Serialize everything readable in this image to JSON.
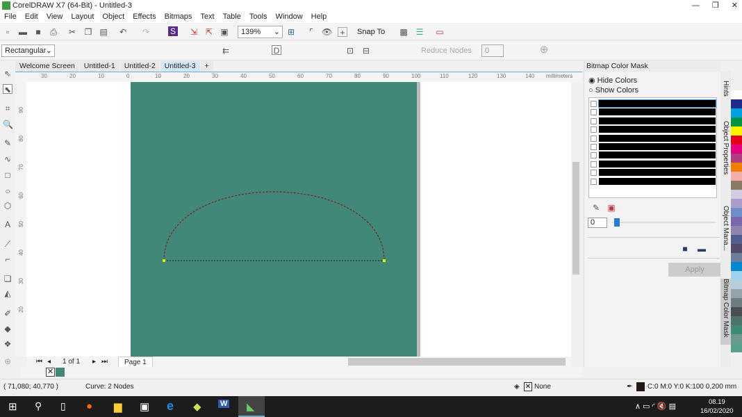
{
  "title": "CorelDRAW X7 (64-Bit) - Untitled-3",
  "menu": [
    "File",
    "Edit",
    "View",
    "Layout",
    "Object",
    "Effects",
    "Bitmaps",
    "Text",
    "Table",
    "Tools",
    "Window",
    "Help"
  ],
  "toolbar": {
    "zoom": "139%",
    "snap_to": "Snap To"
  },
  "property_bar": {
    "selection_mode": "Rectangular",
    "reduce_nodes": "Reduce Nodes",
    "smoothness": "0"
  },
  "tabs": [
    {
      "label": "Welcome Screen"
    },
    {
      "label": "Untitled-1"
    },
    {
      "label": "Untitled-2"
    },
    {
      "label": "Untitled-3",
      "active": true
    }
  ],
  "ruler": {
    "h_labels": [
      "30",
      "20",
      "10",
      "0",
      "10",
      "20",
      "30",
      "40",
      "50",
      "60",
      "70",
      "80",
      "90",
      "100",
      "110",
      "120",
      "130",
      "140"
    ],
    "units": "millimeters",
    "v_labels": [
      "90",
      "80",
      "70",
      "60",
      "50",
      "40",
      "30",
      "20"
    ]
  },
  "page_nav": {
    "count": "1 of 1",
    "page": "Page 1"
  },
  "docker": {
    "title": "Bitmap Color Mask",
    "hide": "Hide Colors",
    "show": "Show Colors",
    "hide_selected": true,
    "tolerance": "0",
    "apply": "Apply",
    "rows": 10
  },
  "docker_tabs": [
    "Hints",
    "Object Properties",
    "Object Mana...",
    "Bitmap Color Mask"
  ],
  "palette": [
    "#ffffff",
    "#1f2a8a",
    "#00a0e3",
    "#00963f",
    "#fff200",
    "#e3001b",
    "#e4007f",
    "#b03d80",
    "#ef7d00",
    "#f3adaa",
    "#8a7967",
    "#d3cde3",
    "#a99dcb",
    "#6f8dc8",
    "#7b67ae",
    "#8e84ae",
    "#4f5f8e",
    "#544a6a",
    "#6c7f9a",
    "#0089d0",
    "#9dd3ef",
    "#b6ccd8",
    "#93a3ad",
    "#6d7b82",
    "#474f55",
    "#4f726c",
    "#3e8a76",
    "#6c9890",
    "#56a08c"
  ],
  "page_color": "#428878",
  "status": {
    "coords": "( 71,080; 40,770 )",
    "object": "Curve: 2 Nodes",
    "fill": "None",
    "outline": "C:0 M:0 Y:0 K:100  0,200 mm"
  },
  "taskbar": {
    "time": "08.19",
    "date": "16/02/2020"
  }
}
